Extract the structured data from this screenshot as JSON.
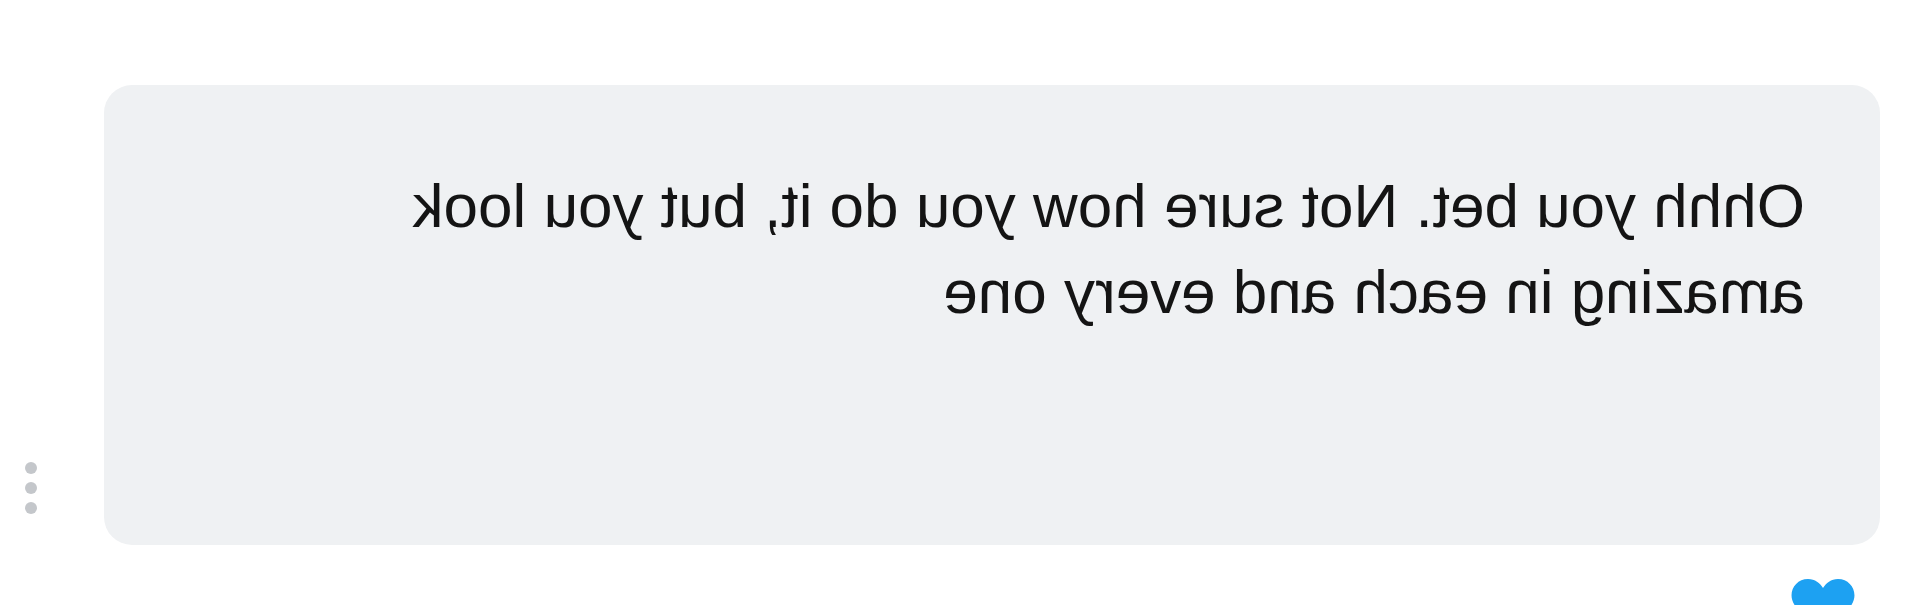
{
  "message": {
    "text": "Ohhh you bet. Not sure how you do it, but you look amazing in each and every one"
  }
}
